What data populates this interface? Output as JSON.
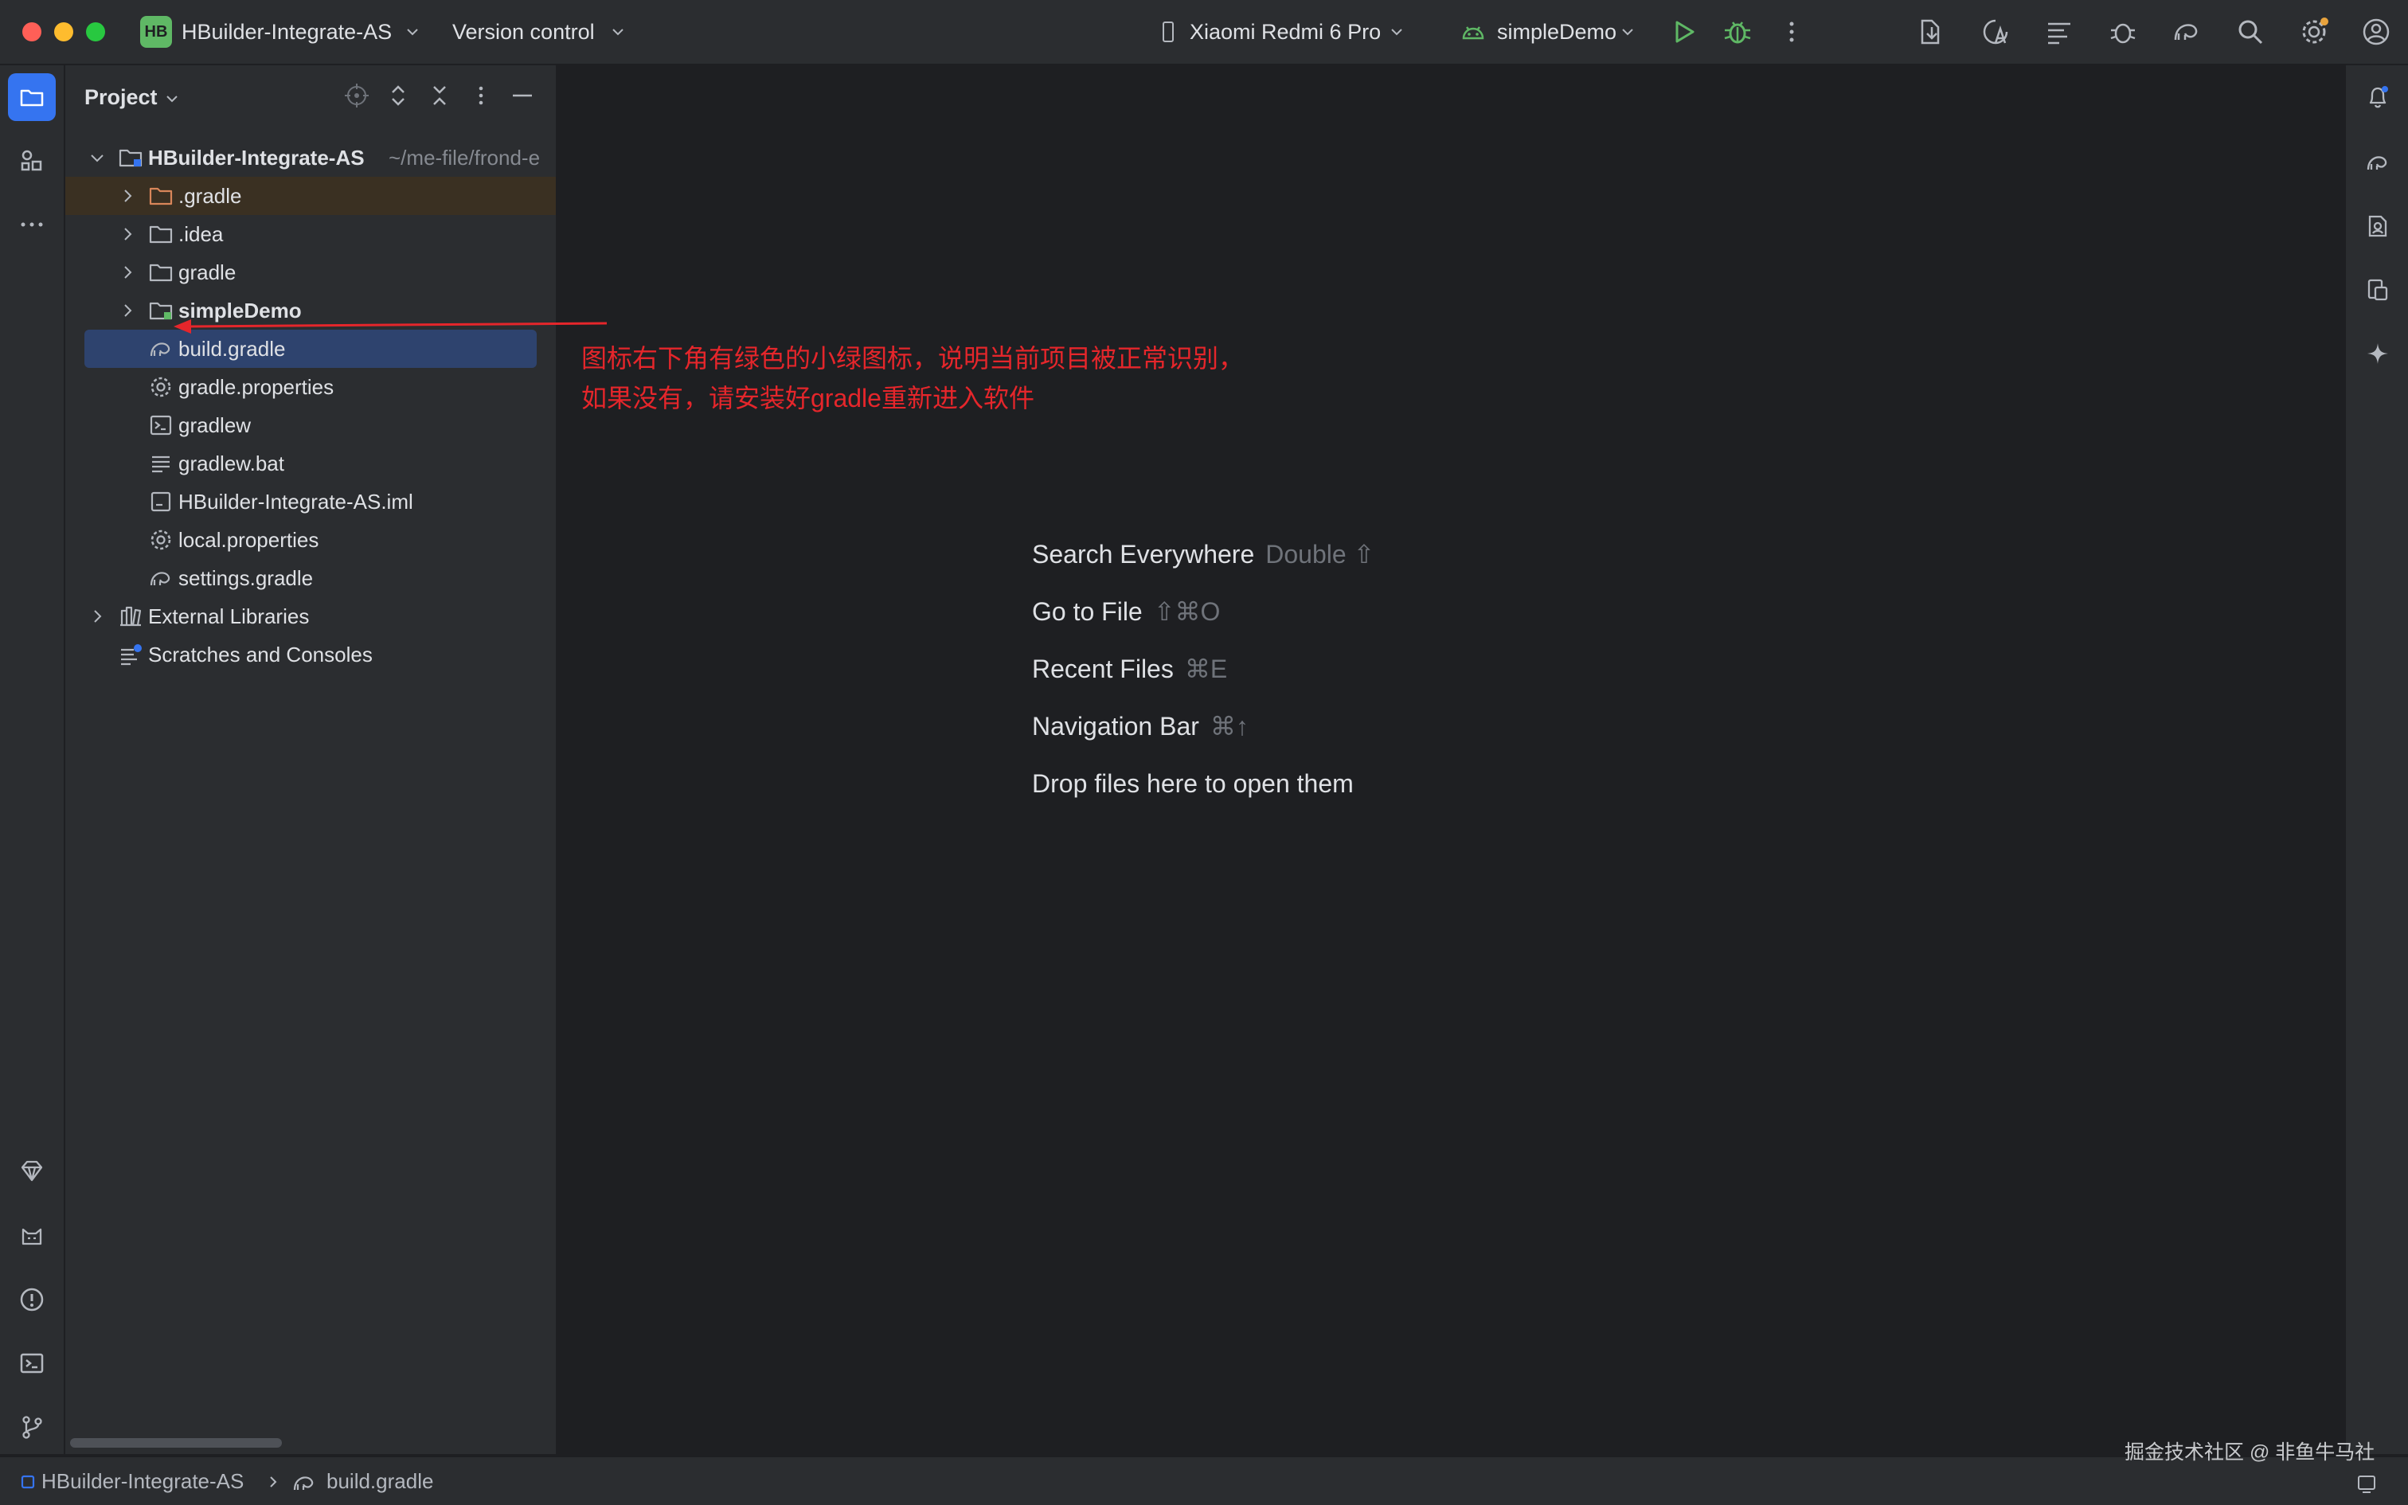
{
  "titlebar": {
    "project_badge": "HB",
    "project_name": "HBuilder-Integrate-AS",
    "vcs_label": "Version control",
    "device": "Xiaomi Redmi 6 Pro",
    "run_config": "simpleDemo"
  },
  "project_panel": {
    "title": "Project",
    "root": {
      "name": "HBuilder-Integrate-AS",
      "path": "~/me-file/frond-e"
    },
    "items": [
      {
        "label": ".gradle"
      },
      {
        "label": ".idea"
      },
      {
        "label": "gradle"
      },
      {
        "label": "simpleDemo"
      },
      {
        "label": "build.gradle"
      },
      {
        "label": "gradle.properties"
      },
      {
        "label": "gradlew"
      },
      {
        "label": "gradlew.bat"
      },
      {
        "label": "HBuilder-Integrate-AS.iml"
      },
      {
        "label": "local.properties"
      },
      {
        "label": "settings.gradle"
      }
    ],
    "external_libraries": "External Libraries",
    "scratches": "Scratches and Consoles"
  },
  "annotation": {
    "line1": "图标右下角有绿色的小绿图标，说明当前项目被正常识别，",
    "line2": "如果没有，请安装好gradle重新进入软件",
    "color": "#e5262b"
  },
  "editor_hints": [
    {
      "label": "Search Everywhere",
      "shortcut": "Double ⇧"
    },
    {
      "label": "Go to File",
      "shortcut": "⇧⌘O"
    },
    {
      "label": "Recent Files",
      "shortcut": "⌘E"
    },
    {
      "label": "Navigation Bar",
      "shortcut": "⌘↑"
    },
    {
      "label": "Drop files here to open them",
      "shortcut": ""
    }
  ],
  "statusbar": {
    "breadcrumb_project": "HBuilder-Integrate-AS",
    "breadcrumb_file": "build.gradle"
  },
  "watermark": "掘金技术社区 @ 非鱼牛马社",
  "icons": {
    "project": "folder-icon",
    "structure": "structure-icon",
    "more": "more-icon",
    "run": "run-icon",
    "debug": "debug-icon",
    "search": "search-icon",
    "settings": "gear-icon",
    "account": "account-icon",
    "notifications": "bell-icon"
  },
  "colors": {
    "accent": "#3574f0",
    "run_green": "#5fb865",
    "selection": "#2e436e",
    "panel_bg": "#2b2d30",
    "editor_bg": "#1e1f22"
  }
}
